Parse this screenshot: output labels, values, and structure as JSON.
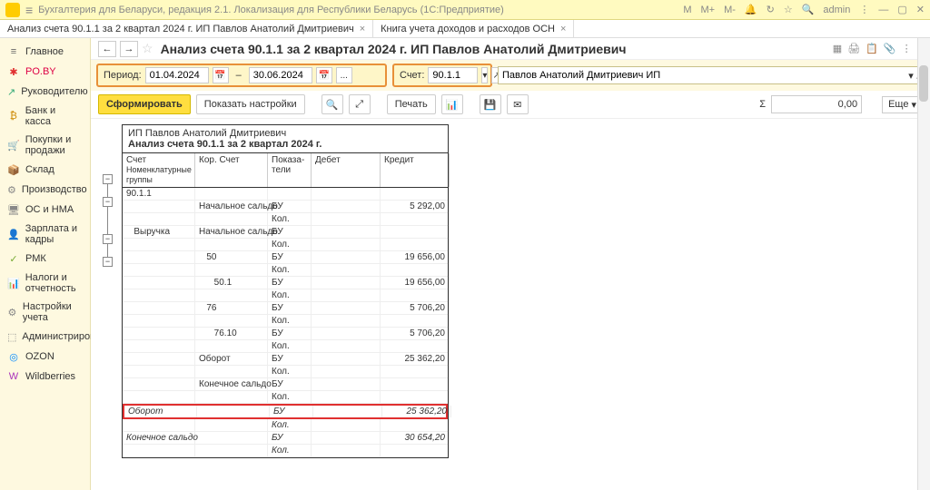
{
  "titlebar": {
    "app_title": "Бухгалтерия для Беларуси, редакция 2.1. Локализация для Республики Беларусь  (1С:Предприятие)",
    "m_labels": [
      "M",
      "M+",
      "M-"
    ],
    "user": "admin"
  },
  "tabs": [
    {
      "label": "Анализ счета 90.1.1 за 2 квартал 2024 г. ИП Павлов Анатолий Дмитриевич"
    },
    {
      "label": "Книга учета доходов и расходов ОСН"
    }
  ],
  "sidebar": {
    "items": [
      {
        "icon": "≡",
        "label": "Главное",
        "color": "#666"
      },
      {
        "icon": "✱",
        "label": "PO.BY",
        "color": "#e03030"
      },
      {
        "icon": "↗",
        "label": "Руководителю",
        "color": "#3a7"
      },
      {
        "icon": "₿",
        "label": "Банк и касса",
        "color": "#c80"
      },
      {
        "icon": "🛒",
        "label": "Покупки и продажи",
        "color": "#888"
      },
      {
        "icon": "📦",
        "label": "Склад",
        "color": "#888"
      },
      {
        "icon": "⚙",
        "label": "Производство",
        "color": "#888"
      },
      {
        "icon": "🖥",
        "label": "ОС и НМА",
        "color": "#888"
      },
      {
        "icon": "👤",
        "label": "Зарплата и кадры",
        "color": "#888"
      },
      {
        "icon": "✓",
        "label": "РМК",
        "color": "#7a3"
      },
      {
        "icon": "📊",
        "label": "Налоги и отчетность",
        "color": "#888"
      },
      {
        "icon": "⚙",
        "label": "Настройки учета",
        "color": "#888"
      },
      {
        "icon": "⬚",
        "label": "Администрирование",
        "color": "#888"
      },
      {
        "icon": "◎",
        "label": "OZON",
        "color": "#08f"
      },
      {
        "icon": "W",
        "label": "Wildberries",
        "color": "#a3b"
      }
    ]
  },
  "page": {
    "title": "Анализ счета 90.1.1 за 2 квартал 2024 г. ИП Павлов Анатолий Дмитриевич",
    "nav_back": "←",
    "nav_fwd": "→"
  },
  "filter": {
    "period_label": "Период:",
    "date_from": "01.04.2024",
    "date_to": "30.06.2024",
    "dash": "–",
    "dots": "...",
    "account_label": "Счет:",
    "account": "90.1.1",
    "org": "Павлов Анатолий Дмитриевич ИП"
  },
  "toolbar": {
    "form": "Сформировать",
    "settings": "Показать настройки",
    "print": "Печать",
    "sum_value": "0,00",
    "more": "Еще"
  },
  "report": {
    "org": "ИП Павлов Анатолий Дмитриевич",
    "title": "Анализ счета 90.1.1 за 2 квартал 2024 г.",
    "headers": {
      "acc": "Счет",
      "sub": "Номенклатурные группы",
      "cor": "Кор. Счет",
      "ind": "Показа-\nтели",
      "debit": "Дебет",
      "credit": "Кредит"
    },
    "rows": [
      {
        "a": "90.1.1",
        "b": "",
        "c": "",
        "d": "",
        "e": ""
      },
      {
        "a": "",
        "b": "Начальное сальдо",
        "c": "БУ",
        "d": "",
        "e": "5 292,00"
      },
      {
        "a": "",
        "b": "",
        "c": "Кол.",
        "d": "",
        "e": ""
      },
      {
        "a": "   Выручка",
        "b": "Начальное сальдо",
        "c": "БУ",
        "d": "",
        "e": ""
      },
      {
        "a": "",
        "b": "",
        "c": "Кол.",
        "d": "",
        "e": ""
      },
      {
        "a": "",
        "b": "   50",
        "c": "БУ",
        "d": "",
        "e": "19 656,00"
      },
      {
        "a": "",
        "b": "",
        "c": "Кол.",
        "d": "",
        "e": ""
      },
      {
        "a": "",
        "b": "      50.1",
        "c": "БУ",
        "d": "",
        "e": "19 656,00"
      },
      {
        "a": "",
        "b": "",
        "c": "Кол.",
        "d": "",
        "e": ""
      },
      {
        "a": "",
        "b": "   76",
        "c": "БУ",
        "d": "",
        "e": "5 706,20"
      },
      {
        "a": "",
        "b": "",
        "c": "Кол.",
        "d": "",
        "e": ""
      },
      {
        "a": "",
        "b": "      76.10",
        "c": "БУ",
        "d": "",
        "e": "5 706,20"
      },
      {
        "a": "",
        "b": "",
        "c": "Кол.",
        "d": "",
        "e": ""
      },
      {
        "a": "",
        "b": "Оборот",
        "c": "БУ",
        "d": "",
        "e": "25 362,20"
      },
      {
        "a": "",
        "b": "",
        "c": "Кол.",
        "d": "",
        "e": ""
      },
      {
        "a": "",
        "b": "Конечное сальдо",
        "c": "БУ",
        "d": "",
        "e": ""
      },
      {
        "a": "",
        "b": "",
        "c": "Кол.",
        "d": "",
        "e": ""
      }
    ],
    "highlight": {
      "a": "Оборот",
      "b": "",
      "c": "БУ",
      "d": "",
      "e": "25 362,20"
    },
    "after": [
      {
        "a": "",
        "b": "",
        "c": "Кол.",
        "d": "",
        "e": ""
      },
      {
        "a": "Конечное сальдо",
        "b": "",
        "c": "БУ",
        "d": "",
        "e": "30 654,20"
      },
      {
        "a": "",
        "b": "",
        "c": "Кол.",
        "d": "",
        "e": ""
      }
    ]
  }
}
